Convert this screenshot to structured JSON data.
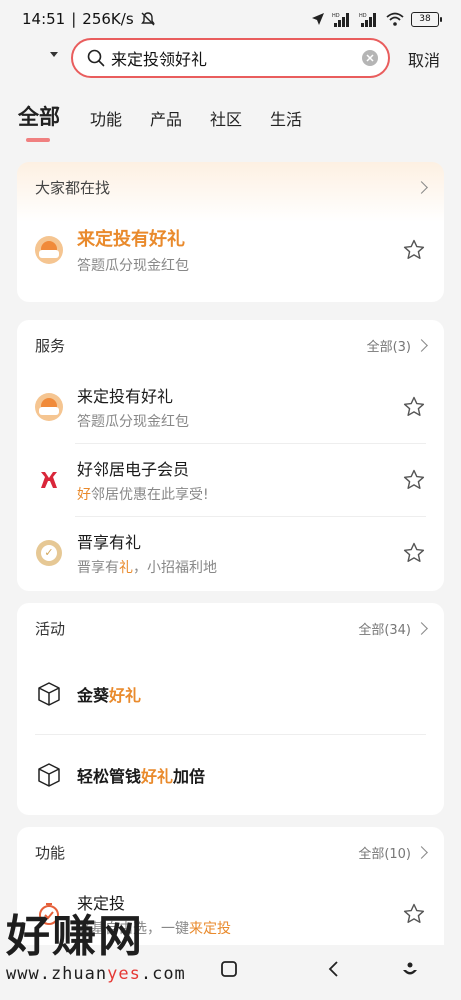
{
  "status_bar": {
    "time": "14:51",
    "speed": "256K/s",
    "battery": "38",
    "icons": [
      "mute-icon",
      "location-icon",
      "signal-hd-icon",
      "signal-hd-icon",
      "wifi-icon",
      "battery-icon"
    ]
  },
  "search": {
    "query": "来定投领好礼",
    "cancel": "取消"
  },
  "tabs": [
    "全部",
    "功能",
    "产品",
    "社区",
    "生活"
  ],
  "popular": {
    "title": "大家都在找",
    "item": {
      "title": "来定投有好礼",
      "subtitle": "答题瓜分现金红包"
    }
  },
  "services": {
    "title": "服务",
    "more": "全部(3)",
    "items": [
      {
        "title": "来定投有好礼",
        "subtitle": "答题瓜分现金红包"
      },
      {
        "title": "好邻居电子会员",
        "subtitle_hl": "好",
        "subtitle_rest": "邻居优惠在此享受!"
      },
      {
        "title": "晋享有礼",
        "subtitle_pre": "晋享有",
        "subtitle_hl": "礼",
        "subtitle_post": "，小招福利地"
      }
    ]
  },
  "activities": {
    "title": "活动",
    "more": "全部(34)",
    "items": [
      {
        "pre": "金葵",
        "hl": "好礼",
        "post": ""
      },
      {
        "pre": "轻松管钱",
        "hl": "好礼",
        "post": "加倍"
      }
    ]
  },
  "functions": {
    "title": "功能",
    "more": "全部(10)",
    "item": {
      "title": "来定投",
      "subtitle_pre": "好基自由选，一键",
      "subtitle_hl": "来定投"
    }
  },
  "watermark": {
    "big": "好赚网",
    "small_pre": "www.zhuan",
    "small_red": "yes",
    "small_post": ".com"
  },
  "colors": {
    "accent": "#e98a2c",
    "search_border": "#e95d5d",
    "tab_underline": "#f08080"
  }
}
